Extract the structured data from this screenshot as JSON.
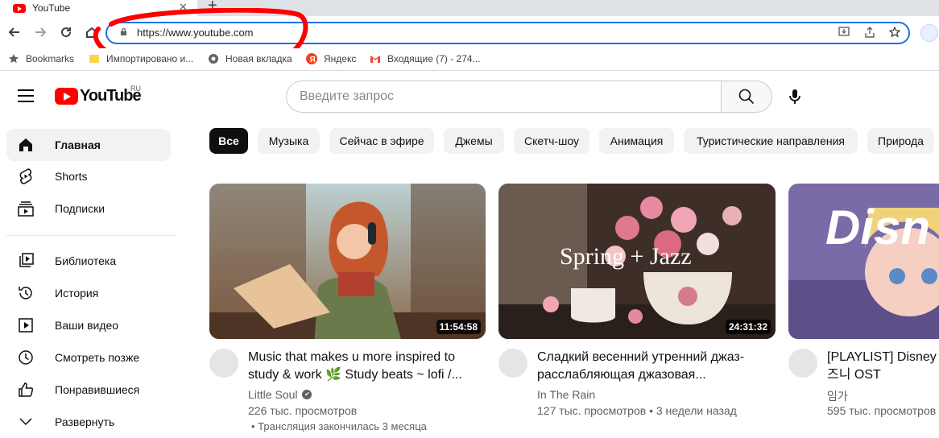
{
  "browser": {
    "tab_title": "YouTube",
    "tab_close": "✕",
    "new_tab": "+",
    "url": "https://www.youtube.com",
    "bookmarks": [
      {
        "label": "Bookmarks",
        "icon": "star-icon"
      },
      {
        "label": "Импортировано и...",
        "icon": "folder-icon"
      },
      {
        "label": "Новая вкладка",
        "icon": "globe-icon"
      },
      {
        "label": "Яндекс",
        "icon": "yandex-icon"
      },
      {
        "label": "Входящие (7) - 274...",
        "icon": "gmail-icon"
      }
    ]
  },
  "header": {
    "logo_text": "YouTube",
    "region": "RU",
    "search_placeholder": "Введите запрос"
  },
  "sidebar": {
    "main": [
      {
        "label": "Главная",
        "icon": "home-icon",
        "active": true
      },
      {
        "label": "Shorts",
        "icon": "shorts-icon"
      },
      {
        "label": "Подписки",
        "icon": "subscriptions-icon"
      }
    ],
    "library": [
      {
        "label": "Библиотека",
        "icon": "library-icon"
      },
      {
        "label": "История",
        "icon": "history-icon"
      },
      {
        "label": "Ваши видео",
        "icon": "your-videos-icon"
      },
      {
        "label": "Смотреть позже",
        "icon": "watch-later-icon"
      },
      {
        "label": "Понравившиеся",
        "icon": "liked-icon"
      },
      {
        "label": "Развернуть",
        "icon": "chevron-down-icon"
      }
    ]
  },
  "chips": [
    "Все",
    "Музыка",
    "Сейчас в эфире",
    "Джемы",
    "Скетч-шоу",
    "Анимация",
    "Туристические направления",
    "Природа"
  ],
  "videos": [
    {
      "title_line1": "Music that makes u more inspired to",
      "title_line2": "study & work 🌿 Study beats ~ lofi /...",
      "channel": "Little Soul",
      "verified": "✔",
      "views": "226 тыс. просмотров",
      "meta2": "• Трансляция закончилась 3 месяца",
      "duration": "11:54:58"
    },
    {
      "title_line1": "Сладкий весенний утренний джаз-",
      "title_line2": "расслабляющая джазовая...",
      "channel": "In The Rain",
      "views": "127 тыс. просмотров • 3 недели назад",
      "duration": "24:31:32",
      "overlay": "Spring + Jazz"
    },
    {
      "title_line1": "[PLAYLIST] Disney s",
      "title_line2": "즈니 OST",
      "channel": "임가",
      "views": "595 тыс. просмотров",
      "overlay": "Disn"
    }
  ]
}
